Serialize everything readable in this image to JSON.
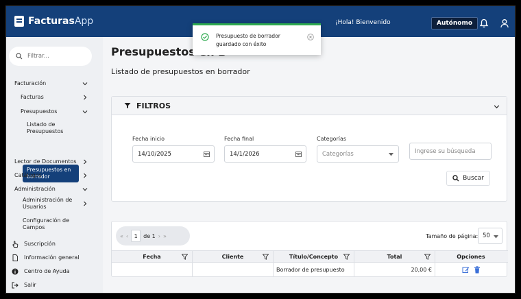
{
  "header": {
    "logo_bold": "Facturas",
    "logo_thin": "App",
    "greeting": "¡Hola! Bienvenido",
    "role": "Autónomo"
  },
  "toast": {
    "message": "Presupuesto de borrador guardado con éxito"
  },
  "sidebar": {
    "search_placeholder": "Filtrar...",
    "facturacion": "Facturación",
    "facturas": "Facturas",
    "presupuestos": "Presupuestos",
    "listado_1": "Listado de",
    "listado_2": "Presupuestos",
    "borrador_1": "Presupuestos en",
    "borrador_2": "borrador",
    "lector": "Lector de Documentos",
    "catalogos": "Catálogos",
    "administracion": "Administración",
    "admin_usuarios_1": "Administración de",
    "admin_usuarios_2": "Usuarios",
    "config_campos_1": "Configuración de",
    "config_campos_2": "Campos",
    "suscripcion": "Suscripción",
    "info_general": "Información general",
    "ayuda": "Centro de Ayuda",
    "salir": "Salir"
  },
  "main": {
    "title": "Presupuestos en B",
    "subtitle": "Listado de presupuestos en borrador"
  },
  "filters": {
    "title": "FILTROS",
    "fecha_inicio_label": "Fecha inicio",
    "fecha_inicio": "14/10/2025",
    "fecha_final_label": "Fecha final",
    "fecha_final": "14/1/2026",
    "categorias_label": "Categorías",
    "categorias_placeholder": "Categorías",
    "busqueda_placeholder": "Ingrese su búsqueda",
    "buscar": "Buscar"
  },
  "grid": {
    "page": "1",
    "page_of": "de 1",
    "page_size_label": "Tamaño de página:",
    "page_size": "50",
    "columns": [
      "Fecha",
      "Cliente",
      "Título/Concepto",
      "Total",
      "Opciones"
    ],
    "rows": [
      {
        "fecha": "",
        "cliente": "",
        "titulo": "Borrador de presupuesto",
        "total": "20,00 €"
      }
    ]
  },
  "colors": {
    "brand": "#14407a",
    "success": "#2eaa4f",
    "action": "#3a6fd8"
  }
}
